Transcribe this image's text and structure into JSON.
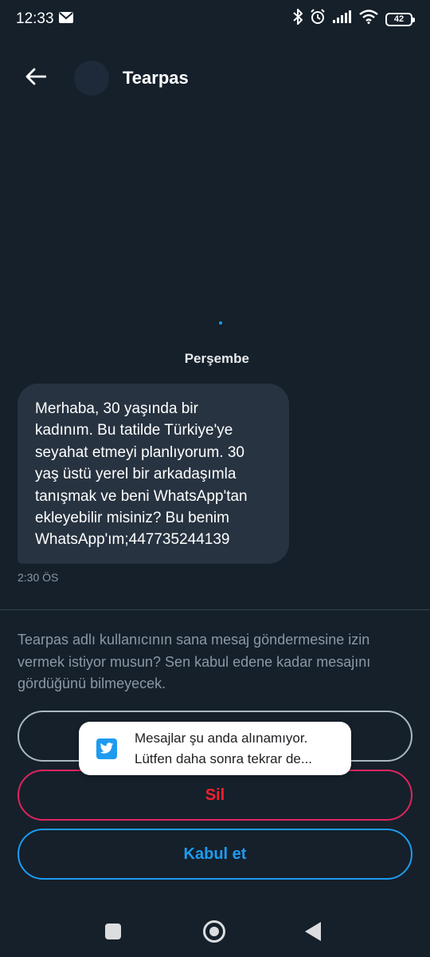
{
  "status_bar": {
    "time": "12:33",
    "battery": "42",
    "icons": [
      "mail-icon",
      "bluetooth-icon",
      "alarm-icon",
      "signal-icon",
      "wifi-icon",
      "battery-icon"
    ]
  },
  "header": {
    "back_icon": "arrow-left-icon",
    "title": "Tearpas"
  },
  "conversation": {
    "day_label": "Perşembe",
    "message": {
      "lines": [
        "Merhaba, 30 yaşında bir",
        "kadınım. Bu tatilde Türkiye'ye",
        "seyahat etmeyi planlıyorum. 30",
        "yaş üstü yerel bir arkadaşımla",
        "tanışmak ve beni WhatsApp'tan",
        "ekleyebilir misiniz? Bu benim",
        "WhatsApp'ım;447735244139"
      ],
      "time": "2:30 ÖS"
    }
  },
  "request": {
    "text_lines": [
      "Tearpas adlı kullanıcının sana mesaj göndermesine izin",
      "vermek istiyor musun? Sen kabul edene kadar mesajını",
      "gördüğünü bilmeyecek."
    ],
    "block_label": "",
    "delete_label": "Sil",
    "accept_label": "Kabul et"
  },
  "toast": {
    "icon": "twitter-bird-icon",
    "line1": "Mesajlar şu anda alınamıyor.",
    "line2": "Lütfen daha sonra tekrar de..."
  },
  "colors": {
    "background": "#15202b",
    "bubble": "#273340",
    "accent": "#1d9bf0",
    "danger": "#f4212e",
    "muted": "#8b98a5"
  }
}
